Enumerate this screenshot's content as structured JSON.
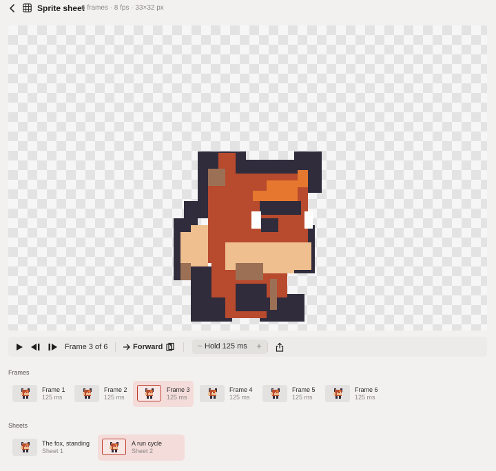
{
  "header": {
    "title": "Sprite sheet",
    "meta": "6 frames · 8 fps · 33×32 px",
    "back_icon": "chevron-left-icon",
    "grid_icon": "grid-icon"
  },
  "toolbar": {
    "frame_indicator": "Frame 3 of 6",
    "direction_label": "Forward",
    "hold_label": "Hold 125 ms",
    "hold_minus": "−",
    "hold_plus": "+"
  },
  "frames_section": {
    "label": "Frames",
    "items": [
      {
        "title": "Frame 1",
        "duration": "125 ms",
        "selected": false
      },
      {
        "title": "Frame 2",
        "duration": "125 ms",
        "selected": false
      },
      {
        "title": "Frame 3",
        "duration": "125 ms",
        "selected": true
      },
      {
        "title": "Frame 4",
        "duration": "125 ms",
        "selected": false
      },
      {
        "title": "Frame 5",
        "duration": "125 ms",
        "selected": false
      },
      {
        "title": "Frame 6",
        "duration": "125 ms",
        "selected": false
      }
    ]
  },
  "sheets_section": {
    "label": "Sheets",
    "items": [
      {
        "title": "The fox, standing",
        "subtitle": "Sheet 1",
        "selected": false
      },
      {
        "title": "A run cycle",
        "subtitle": "Sheet 2",
        "selected": true
      }
    ]
  },
  "colors": {
    "background": "#f3f1ef",
    "accent_selected": "#c0392b",
    "selected_card_bg": "#f3dcd9",
    "fox_red": "#b84a2e",
    "fox_orange": "#e5782e",
    "fox_cream": "#efbf8f",
    "fox_brown": "#9c7055",
    "outline": "#302c3c"
  }
}
